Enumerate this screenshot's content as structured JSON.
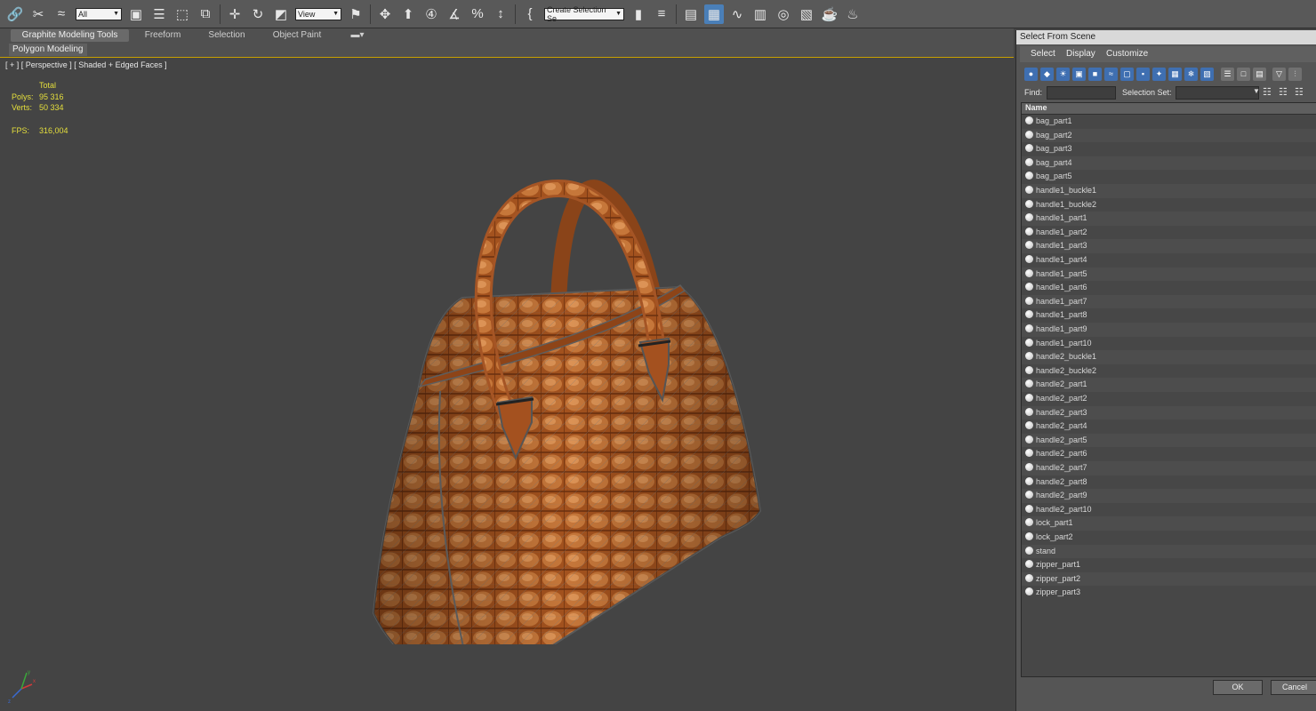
{
  "toolbar": {
    "filter_value": "All",
    "coord_value": "View",
    "selection_set_placeholder": "Create Selection Se",
    "icons": [
      "link-icon",
      "unlink-icon",
      "bind-spacewarp-icon",
      "select-object-icon",
      "select-by-name-icon",
      "rect-region-icon",
      "window-crossing-icon",
      "move-icon",
      "rotate-icon",
      "scale-icon",
      "select-manipulate-icon",
      "pivot-icon",
      "keyboard-shortcut-icon",
      "snap-3d-icon",
      "angle-snap-icon",
      "percent-snap-icon",
      "spinner-snap-icon",
      "edit-named-sets-icon",
      "mirror-icon",
      "align-icon",
      "layer-manager-icon",
      "graphite-icon",
      "curve-editor-icon",
      "schematic-view-icon",
      "material-editor-icon",
      "render-setup-icon",
      "rendered-frame-icon",
      "render-icon",
      "render-iterative-icon"
    ]
  },
  "ribbon": {
    "tabs": [
      "Graphite Modeling Tools",
      "Freeform",
      "Selection",
      "Object Paint"
    ],
    "active_tab": "Graphite Modeling Tools",
    "panel": "Polygon Modeling"
  },
  "viewport": {
    "label": "[ + ] [ Perspective ] [ Shaded + Edged Faces ]",
    "stats": {
      "total_label": "Total",
      "polys_label": "Polys:",
      "polys_value": "95 316",
      "verts_label": "Verts:",
      "verts_value": "50 334",
      "fps_label": "FPS:",
      "fps_value": "316,004"
    },
    "axis_labels": {
      "x": "x",
      "y": "y",
      "z": "z"
    }
  },
  "dialog": {
    "title": "Select From Scene",
    "menu": [
      "Select",
      "Display",
      "Customize"
    ],
    "find_label": "Find:",
    "selection_set_label": "Selection Set:",
    "column_name": "Name",
    "items": [
      "bag_part1",
      "bag_part2",
      "bag_part3",
      "bag_part4",
      "bag_part5",
      "handle1_buckle1",
      "handle1_buckle2",
      "handle1_part1",
      "handle1_part2",
      "handle1_part3",
      "handle1_part4",
      "handle1_part5",
      "handle1_part6",
      "handle1_part7",
      "handle1_part8",
      "handle1_part9",
      "handle1_part10",
      "handle2_buckle1",
      "handle2_buckle2",
      "handle2_part1",
      "handle2_part2",
      "handle2_part3",
      "handle2_part4",
      "handle2_part5",
      "handle2_part6",
      "handle2_part7",
      "handle2_part8",
      "handle2_part9",
      "handle2_part10",
      "lock_part1",
      "lock_part2",
      "stand",
      "zipper_part1",
      "zipper_part2",
      "zipper_part3"
    ],
    "ok_label": "OK",
    "cancel_label": "Cancel"
  }
}
